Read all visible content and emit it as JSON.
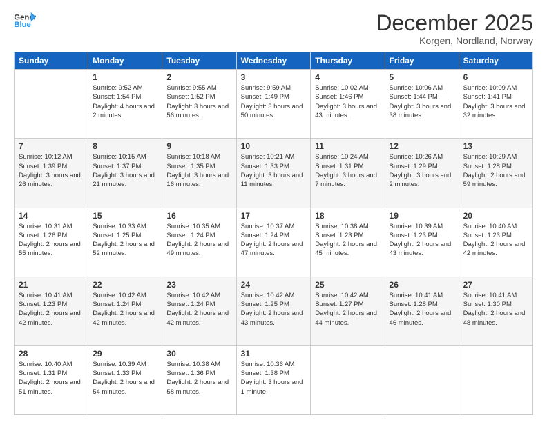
{
  "logo": {
    "line1": "General",
    "line2": "Blue"
  },
  "title": "December 2025",
  "subtitle": "Korgen, Nordland, Norway",
  "headers": [
    "Sunday",
    "Monday",
    "Tuesday",
    "Wednesday",
    "Thursday",
    "Friday",
    "Saturday"
  ],
  "weeks": [
    [
      {
        "date": "",
        "sunrise": "",
        "sunset": "",
        "daylight": "",
        "empty": true
      },
      {
        "date": "1",
        "sunrise": "Sunrise: 9:52 AM",
        "sunset": "Sunset: 1:54 PM",
        "daylight": "Daylight: 4 hours and 2 minutes."
      },
      {
        "date": "2",
        "sunrise": "Sunrise: 9:55 AM",
        "sunset": "Sunset: 1:52 PM",
        "daylight": "Daylight: 3 hours and 56 minutes."
      },
      {
        "date": "3",
        "sunrise": "Sunrise: 9:59 AM",
        "sunset": "Sunset: 1:49 PM",
        "daylight": "Daylight: 3 hours and 50 minutes."
      },
      {
        "date": "4",
        "sunrise": "Sunrise: 10:02 AM",
        "sunset": "Sunset: 1:46 PM",
        "daylight": "Daylight: 3 hours and 43 minutes."
      },
      {
        "date": "5",
        "sunrise": "Sunrise: 10:06 AM",
        "sunset": "Sunset: 1:44 PM",
        "daylight": "Daylight: 3 hours and 38 minutes."
      },
      {
        "date": "6",
        "sunrise": "Sunrise: 10:09 AM",
        "sunset": "Sunset: 1:41 PM",
        "daylight": "Daylight: 3 hours and 32 minutes."
      }
    ],
    [
      {
        "date": "7",
        "sunrise": "Sunrise: 10:12 AM",
        "sunset": "Sunset: 1:39 PM",
        "daylight": "Daylight: 3 hours and 26 minutes."
      },
      {
        "date": "8",
        "sunrise": "Sunrise: 10:15 AM",
        "sunset": "Sunset: 1:37 PM",
        "daylight": "Daylight: 3 hours and 21 minutes."
      },
      {
        "date": "9",
        "sunrise": "Sunrise: 10:18 AM",
        "sunset": "Sunset: 1:35 PM",
        "daylight": "Daylight: 3 hours and 16 minutes."
      },
      {
        "date": "10",
        "sunrise": "Sunrise: 10:21 AM",
        "sunset": "Sunset: 1:33 PM",
        "daylight": "Daylight: 3 hours and 11 minutes."
      },
      {
        "date": "11",
        "sunrise": "Sunrise: 10:24 AM",
        "sunset": "Sunset: 1:31 PM",
        "daylight": "Daylight: 3 hours and 7 minutes."
      },
      {
        "date": "12",
        "sunrise": "Sunrise: 10:26 AM",
        "sunset": "Sunset: 1:29 PM",
        "daylight": "Daylight: 3 hours and 2 minutes."
      },
      {
        "date": "13",
        "sunrise": "Sunrise: 10:29 AM",
        "sunset": "Sunset: 1:28 PM",
        "daylight": "Daylight: 2 hours and 59 minutes."
      }
    ],
    [
      {
        "date": "14",
        "sunrise": "Sunrise: 10:31 AM",
        "sunset": "Sunset: 1:26 PM",
        "daylight": "Daylight: 2 hours and 55 minutes."
      },
      {
        "date": "15",
        "sunrise": "Sunrise: 10:33 AM",
        "sunset": "Sunset: 1:25 PM",
        "daylight": "Daylight: 2 hours and 52 minutes."
      },
      {
        "date": "16",
        "sunrise": "Sunrise: 10:35 AM",
        "sunset": "Sunset: 1:24 PM",
        "daylight": "Daylight: 2 hours and 49 minutes."
      },
      {
        "date": "17",
        "sunrise": "Sunrise: 10:37 AM",
        "sunset": "Sunset: 1:24 PM",
        "daylight": "Daylight: 2 hours and 47 minutes."
      },
      {
        "date": "18",
        "sunrise": "Sunrise: 10:38 AM",
        "sunset": "Sunset: 1:23 PM",
        "daylight": "Daylight: 2 hours and 45 minutes."
      },
      {
        "date": "19",
        "sunrise": "Sunrise: 10:39 AM",
        "sunset": "Sunset: 1:23 PM",
        "daylight": "Daylight: 2 hours and 43 minutes."
      },
      {
        "date": "20",
        "sunrise": "Sunrise: 10:40 AM",
        "sunset": "Sunset: 1:23 PM",
        "daylight": "Daylight: 2 hours and 42 minutes."
      }
    ],
    [
      {
        "date": "21",
        "sunrise": "Sunrise: 10:41 AM",
        "sunset": "Sunset: 1:23 PM",
        "daylight": "Daylight: 2 hours and 42 minutes."
      },
      {
        "date": "22",
        "sunrise": "Sunrise: 10:42 AM",
        "sunset": "Sunset: 1:24 PM",
        "daylight": "Daylight: 2 hours and 42 minutes."
      },
      {
        "date": "23",
        "sunrise": "Sunrise: 10:42 AM",
        "sunset": "Sunset: 1:24 PM",
        "daylight": "Daylight: 2 hours and 42 minutes."
      },
      {
        "date": "24",
        "sunrise": "Sunrise: 10:42 AM",
        "sunset": "Sunset: 1:25 PM",
        "daylight": "Daylight: 2 hours and 43 minutes."
      },
      {
        "date": "25",
        "sunrise": "Sunrise: 10:42 AM",
        "sunset": "Sunset: 1:27 PM",
        "daylight": "Daylight: 2 hours and 44 minutes."
      },
      {
        "date": "26",
        "sunrise": "Sunrise: 10:41 AM",
        "sunset": "Sunset: 1:28 PM",
        "daylight": "Daylight: 2 hours and 46 minutes."
      },
      {
        "date": "27",
        "sunrise": "Sunrise: 10:41 AM",
        "sunset": "Sunset: 1:30 PM",
        "daylight": "Daylight: 2 hours and 48 minutes."
      }
    ],
    [
      {
        "date": "28",
        "sunrise": "Sunrise: 10:40 AM",
        "sunset": "Sunset: 1:31 PM",
        "daylight": "Daylight: 2 hours and 51 minutes."
      },
      {
        "date": "29",
        "sunrise": "Sunrise: 10:39 AM",
        "sunset": "Sunset: 1:33 PM",
        "daylight": "Daylight: 2 hours and 54 minutes."
      },
      {
        "date": "30",
        "sunrise": "Sunrise: 10:38 AM",
        "sunset": "Sunset: 1:36 PM",
        "daylight": "Daylight: 2 hours and 58 minutes."
      },
      {
        "date": "31",
        "sunrise": "Sunrise: 10:36 AM",
        "sunset": "Sunset: 1:38 PM",
        "daylight": "Daylight: 3 hours and 1 minute."
      },
      {
        "date": "",
        "sunrise": "",
        "sunset": "",
        "daylight": "",
        "empty": true
      },
      {
        "date": "",
        "sunrise": "",
        "sunset": "",
        "daylight": "",
        "empty": true
      },
      {
        "date": "",
        "sunrise": "",
        "sunset": "",
        "daylight": "",
        "empty": true
      }
    ]
  ]
}
